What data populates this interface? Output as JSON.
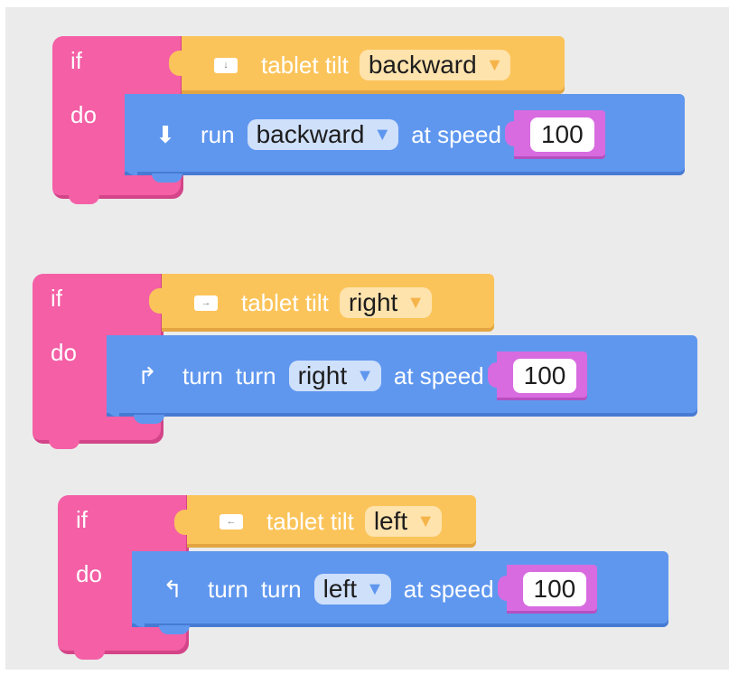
{
  "blocks": [
    {
      "if_label": "if",
      "do_label": "do",
      "condition": {
        "icon": "tablet-tilt-backward-icon",
        "label": "tablet tilt",
        "value": "backward"
      },
      "action": {
        "icon": "arrow-down-icon",
        "verb": "run",
        "direction": "backward",
        "speed_label": "at speed",
        "speed": "100"
      }
    },
    {
      "if_label": "if",
      "do_label": "do",
      "condition": {
        "icon": "tablet-tilt-right-icon",
        "label": "tablet tilt",
        "value": "right"
      },
      "action": {
        "icon": "turn-right-icon",
        "verb": "turn",
        "verb2": "turn",
        "direction": "right",
        "speed_label": "at speed",
        "speed": "100"
      }
    },
    {
      "if_label": "if",
      "do_label": "do",
      "condition": {
        "icon": "tablet-tilt-left-icon",
        "label": "tablet tilt",
        "value": "left"
      },
      "action": {
        "icon": "turn-left-icon",
        "verb": "turn",
        "verb2": "turn",
        "direction": "left",
        "speed_label": "at speed",
        "speed": "100"
      }
    }
  ],
  "colors": {
    "control_pink": "#f45fa6",
    "sensor_orange": "#fbc45a",
    "motion_blue": "#5f97ef",
    "number_purple": "#d86be0",
    "workspace": "#ebebeb"
  }
}
